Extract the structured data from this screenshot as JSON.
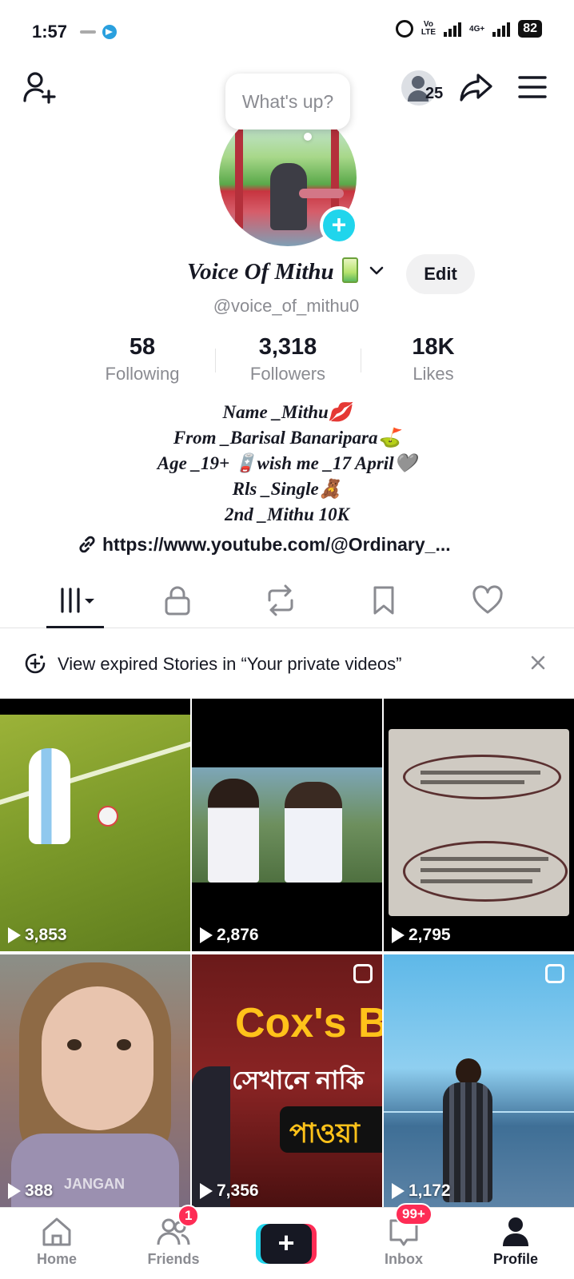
{
  "status_bar": {
    "time": "1:57",
    "battery": "82",
    "network_top": "Vo",
    "network_bottom": "LTE",
    "network_4g": "4G+"
  },
  "header": {
    "viewers_count": "25"
  },
  "avatar": {
    "bubble_text": "What's up?"
  },
  "profile": {
    "display_name": "Voice Of Mithu",
    "username": "@voice_of_mithu0",
    "edit_label": "Edit"
  },
  "stats": [
    {
      "value": "58",
      "label": "Following"
    },
    {
      "value": "3,318",
      "label": "Followers"
    },
    {
      "value": "18K",
      "label": "Likes"
    }
  ],
  "bio": {
    "lines": [
      "Name _Mithu💋",
      "From _Barisal Banaripara⛳",
      "Age _19+ 🪫wish me _17 April🩶",
      "Rls _Single🧸",
      "2nd _Mithu 10K"
    ],
    "link": "https://www.youtube.com/@Ordinary_..."
  },
  "tabs": [
    "videos",
    "private",
    "reposts",
    "favorites",
    "liked"
  ],
  "banner": {
    "text": "View expired Stories in “Your private videos”"
  },
  "videos": [
    {
      "views": "3,853",
      "theme": "football"
    },
    {
      "views": "2,876",
      "theme": "couple"
    },
    {
      "views": "2,795",
      "theme": "comments"
    },
    {
      "views": "388",
      "theme": "girl",
      "overlay": "JANGAN"
    },
    {
      "views": "7,356",
      "theme": "coxs",
      "overlay_top": "Cox's B",
      "overlay_mid": "সেখানে নাকি",
      "overlay_bottom": "পাওয়া"
    },
    {
      "views": "1,172",
      "theme": "beach"
    }
  ],
  "bottom_nav": {
    "home": "Home",
    "friends": "Friends",
    "friends_badge": "1",
    "inbox": "Inbox",
    "inbox_badge": "99+",
    "profile": "Profile"
  },
  "colors": {
    "accent_cyan": "#20d5ec",
    "accent_pink": "#fe2c55",
    "text": "#161823",
    "muted": "#8a8b91"
  }
}
